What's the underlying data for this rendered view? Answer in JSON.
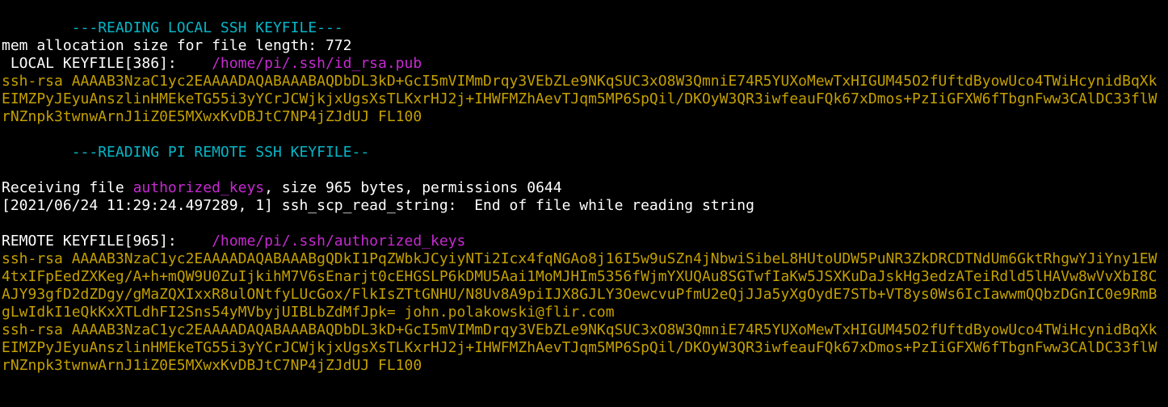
{
  "terminal": {
    "lines": [
      {
        "segments": [
          {
            "text": "        ---READING LOCAL SSH KEYFILE---",
            "color": "cyan"
          }
        ]
      },
      {
        "segments": [
          {
            "text": "mem allocation size for file length: 772",
            "color": "white"
          }
        ]
      },
      {
        "segments": [
          {
            "text": " LOCAL KEYFILE[386]:    ",
            "color": "white"
          },
          {
            "text": "/home/pi/.ssh/id_rsa.pub",
            "color": "magenta"
          }
        ]
      },
      {
        "segments": [
          {
            "text": "ssh-rsa AAAAB3NzaC1yc2EAAAADAQABAAABAQDbDL3kD+GcI5mVIMmDrqy3VEbZLe9NKqSUC3xO8W3QmniE74R5YUXoMewTxHIGUM45O2fUftdByowUco4TWiHcynidBqXk",
            "color": "yellow"
          }
        ]
      },
      {
        "segments": [
          {
            "text": "EIMZPyJEyuAnszlinHMEkeTG55i3yYCrJCWjkjxUgsXsTLKxrHJ2j+IHWFMZhAevTJqm5MP6SpQil/DKOyW3QR3iwfeauFQk67xDmos+PzIiGFXW6fTbgnFww3CAlDC33flW",
            "color": "yellow"
          }
        ]
      },
      {
        "segments": [
          {
            "text": "rNZnpk3twnwArnJ1iZ0E5MXwxKvDBJtC7NP4jZJdUJ FL100",
            "color": "yellow"
          }
        ]
      },
      {
        "segments": [
          {
            "text": "",
            "color": "white"
          }
        ]
      },
      {
        "segments": [
          {
            "text": "        ---READING PI REMOTE SSH KEYFILE--",
            "color": "cyan"
          }
        ]
      },
      {
        "segments": [
          {
            "text": "",
            "color": "white"
          }
        ]
      },
      {
        "segments": [
          {
            "text": "Receiving file ",
            "color": "white"
          },
          {
            "text": "authorized_keys",
            "color": "magenta"
          },
          {
            "text": ", size 965 bytes, permissions 0644",
            "color": "white"
          }
        ]
      },
      {
        "segments": [
          {
            "text": "[2021/06/24 11:29:24.497289, 1] ssh_scp_read_string:  End of file while reading string",
            "color": "white"
          }
        ]
      },
      {
        "segments": [
          {
            "text": "",
            "color": "white"
          }
        ]
      },
      {
        "segments": [
          {
            "text": "REMOTE KEYFILE[965]:    ",
            "color": "white"
          },
          {
            "text": "/home/pi/.ssh/authorized_keys",
            "color": "magenta"
          }
        ]
      },
      {
        "segments": [
          {
            "text": "ssh-rsa AAAAB3NzaC1yc2EAAAADAQABAAABgQDkI1PqZWbkJCyiyNTi2Icx4fqNGAo8j16I5w9uSZn4jNbwiSibeL8HUtoUDW5PuNR3ZkDRCDTNdUm6GktRhgwYJiYny1EW",
            "color": "yellow"
          }
        ]
      },
      {
        "segments": [
          {
            "text": "4txIFpEedZXKeg/A+h+mQW9U0ZuIjkihM7V6sEnarjt0cEHGSLP6kDMU5Aai1MoMJHIm5356fWjmYXUQAu8SGTwfIaKw5JSXKuDaJskHg3edzATeiRdld5lHAVw8wVvXbI8C",
            "color": "yellow"
          }
        ]
      },
      {
        "segments": [
          {
            "text": "AJY93gfD2dZDgy/gMaZQXIxxR8ulONtfyLUcGox/FlkIsZTtGNHU/N8Uv8A9piIJX8GJLY3OewcvuPfmU2eQjJJa5yXgOydE7STb+VT8ys0Ws6IcIawwmQQbzDGnIC0e9RmB",
            "color": "yellow"
          }
        ]
      },
      {
        "segments": [
          {
            "text": "gLwIdkI1eQkKxXTLdhFI2Sns54yMVbyjUIBLbZdMfJpk= john.polakowski@flir.com",
            "color": "yellow"
          }
        ]
      },
      {
        "segments": [
          {
            "text": "ssh-rsa AAAAB3NzaC1yc2EAAAADAQABAAABAQDbDL3kD+GcI5mVIMmDrqy3VEbZLe9NKqSUC3xO8W3QmniE74R5YUXoMewTxHIGUM45O2fUftdByowUco4TWiHcynidBqXk",
            "color": "yellow"
          }
        ]
      },
      {
        "segments": [
          {
            "text": "EIMZPyJEyuAnszlinHMEkeTG55i3yYCrJCWjkjxUgsXsTLKxrHJ2j+IHWFMZhAevTJqm5MP6SpQil/DKOyW3QR3iwfeauFQk67xDmos+PzIiGFXW6fTbgnFww3CAlDC33flW",
            "color": "yellow"
          }
        ]
      },
      {
        "segments": [
          {
            "text": "rNZnpk3twnwArnJ1iZ0E5MXwxKvDBJtC7NP4jZJdUJ FL100",
            "color": "yellow"
          }
        ]
      }
    ]
  }
}
